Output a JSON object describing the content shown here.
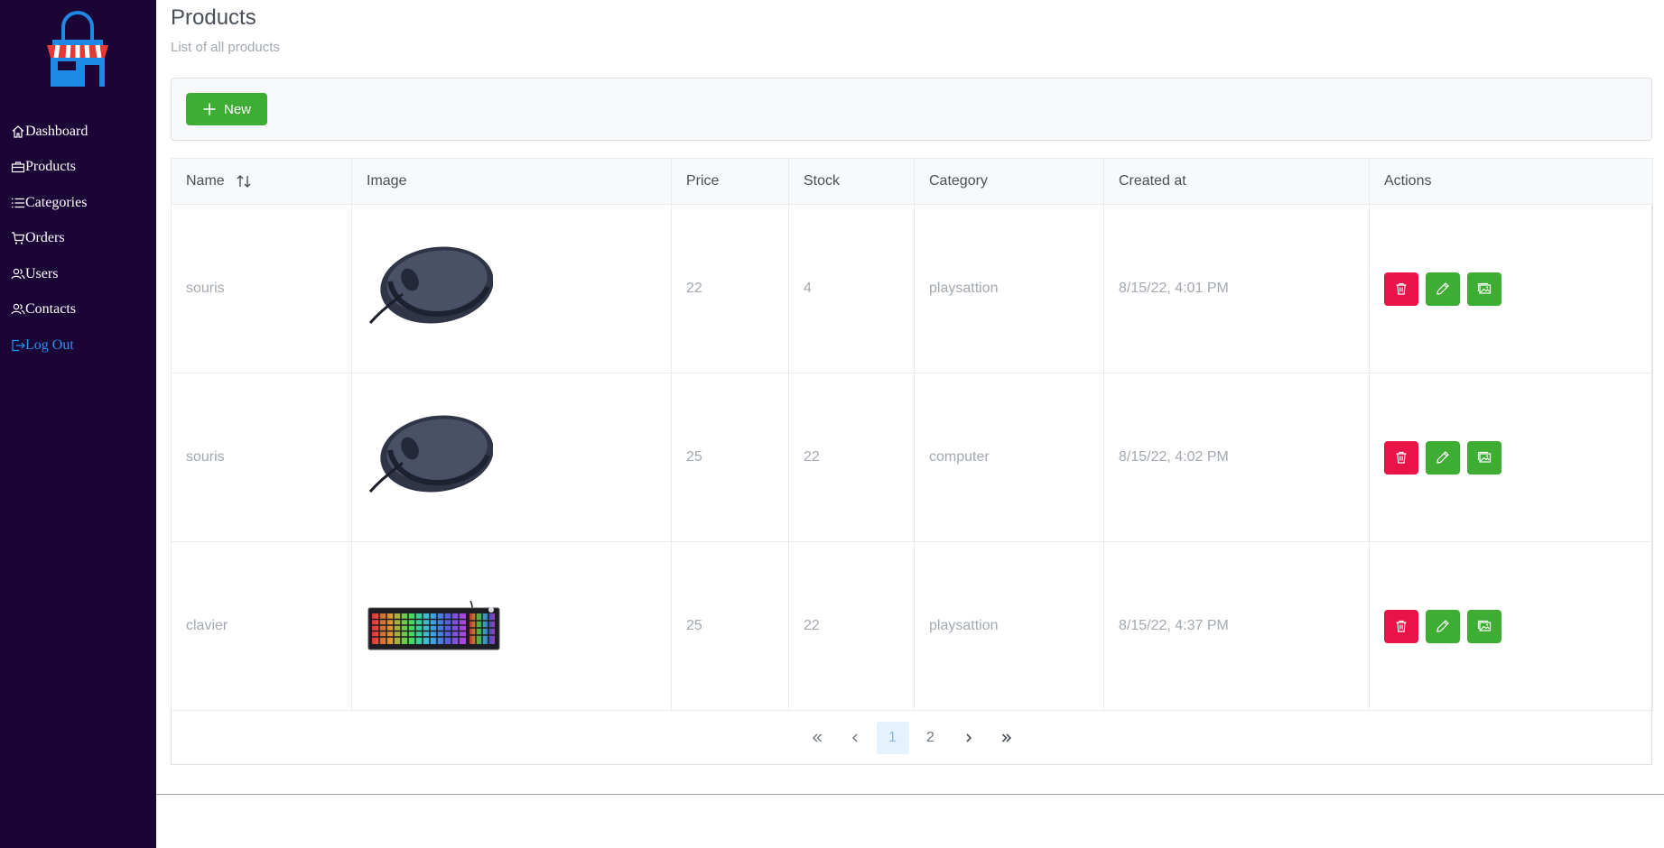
{
  "sidebar": {
    "items": [
      {
        "label": "Dashboard",
        "icon": "home-icon"
      },
      {
        "label": "Products",
        "icon": "briefcase-icon"
      },
      {
        "label": "Categories",
        "icon": "list-icon"
      },
      {
        "label": "Orders",
        "icon": "cart-icon"
      },
      {
        "label": "Users",
        "icon": "users-icon"
      },
      {
        "label": "Contacts",
        "icon": "users-icon"
      },
      {
        "label": "Log Out",
        "icon": "logout-icon"
      }
    ]
  },
  "page": {
    "title": "Products",
    "subtitle": "List of all products"
  },
  "toolbar": {
    "new_label": "New"
  },
  "table": {
    "columns": [
      "Name",
      "Image",
      "Price",
      "Stock",
      "Category",
      "Created at",
      "Actions"
    ],
    "rows": [
      {
        "name": "souris",
        "image": "computer mouse",
        "price": "22",
        "stock": "4",
        "category": "playsattion",
        "created_at": "8/15/22, 4:01 PM"
      },
      {
        "name": "souris",
        "image": "computer mouse",
        "price": "25",
        "stock": "22",
        "category": "computer",
        "created_at": "8/15/22, 4:02 PM"
      },
      {
        "name": "clavier",
        "image": "rgb keyboard",
        "price": "25",
        "stock": "22",
        "category": "playsattion",
        "created_at": "8/15/22, 4:37 PM"
      }
    ]
  },
  "pagination": {
    "pages": [
      "1",
      "2"
    ],
    "current": "1"
  },
  "colors": {
    "sidebar_bg": "#1b0436",
    "success": "#3ead34",
    "danger": "#ea1347",
    "logout_link": "#2196f3"
  }
}
